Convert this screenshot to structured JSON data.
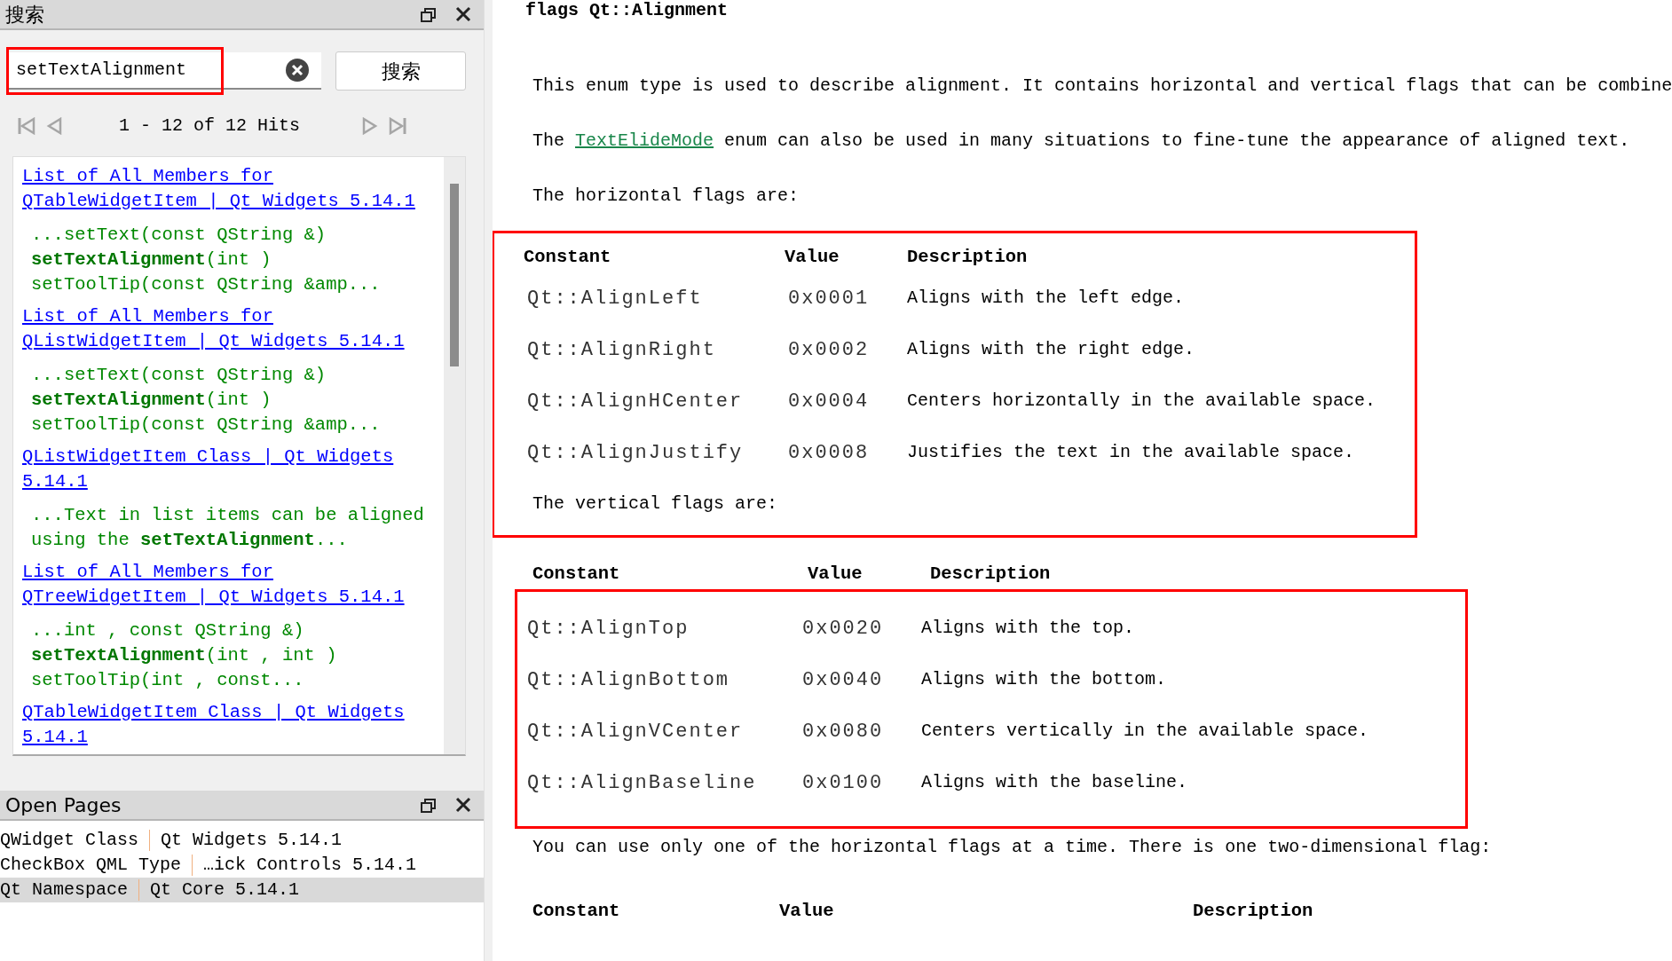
{
  "search_panel": {
    "title": "搜索",
    "query": "setTextAlignment",
    "query_framed": true,
    "search_button": "搜索",
    "hits": "1 - 12 of 12 Hits",
    "results": [
      {
        "title": "List of All Members for QTableWidgetItem | Qt Widgets 5.14.1",
        "snippet": "...setText(const QString &) **setTextAlignment**(int ) setToolTip(const QString &amp..."
      },
      {
        "title": "List of All Members for QListWidgetItem | Qt Widgets 5.14.1",
        "snippet": "...setText(const QString &) **setTextAlignment**(int ) setToolTip(const QString &amp..."
      },
      {
        "title": "QListWidgetItem Class | Qt Widgets 5.14.1",
        "snippet": "...Text in list items can be aligned using the **setTextAlignment**..."
      },
      {
        "title": "List of All Members for QTreeWidgetItem | Qt Widgets 5.14.1",
        "snippet": "...int , const QString &) **setTextAlignment**(int , int ) setToolTip(int , const..."
      },
      {
        "title": "QTableWidgetItem Class | Qt Widgets 5.14.1"
      }
    ]
  },
  "open_pages": {
    "title": "Open Pages",
    "items": [
      {
        "page": "QWidget Class",
        "module": "Qt Widgets 5.14.1",
        "selected": false
      },
      {
        "page": "CheckBox QML Type",
        "module": "…ick Controls 5.14.1",
        "selected": false
      },
      {
        "page": "Qt Namespace",
        "module": "Qt Core 5.14.1",
        "selected": true
      }
    ]
  },
  "document": {
    "blocks": [
      {
        "kind": "heading",
        "text": "flags Qt::Alignment"
      },
      {
        "kind": "paragraph",
        "parts": [
          {
            "text": "This enum type is used to describe alignment. It contains horizontal and vertical flags that can be combine"
          }
        ]
      },
      {
        "kind": "paragraph",
        "parts": [
          {
            "text": "The "
          },
          {
            "text": "TextElideMode",
            "link": true
          },
          {
            "text": " enum can also be used in many situations to fine-tune the appearance of aligned text."
          }
        ]
      },
      {
        "kind": "paragraph",
        "parts": [
          {
            "text": "The horizontal flags are:"
          }
        ]
      },
      {
        "kind": "table",
        "framed": true,
        "columns": [
          "Constant",
          "Value",
          "Description"
        ],
        "rows": [
          [
            "Qt::AlignLeft",
            "0x0001",
            "Aligns with the left edge."
          ],
          [
            "Qt::AlignRight",
            "0x0002",
            "Aligns with the right edge."
          ],
          [
            "Qt::AlignHCenter",
            "0x0004",
            "Centers horizontally in the available space."
          ],
          [
            "Qt::AlignJustify",
            "0x0008",
            "Justifies the text in the available space."
          ]
        ]
      },
      {
        "kind": "paragraph",
        "framed": true,
        "parts": [
          {
            "text": "The vertical flags are:"
          }
        ]
      },
      {
        "kind": "table",
        "rows_framed": true,
        "columns": [
          "Constant",
          "Value",
          "Description"
        ],
        "rows": [
          [
            "Qt::AlignTop",
            "0x0020",
            "Aligns with the top."
          ],
          [
            "Qt::AlignBottom",
            "0x0040",
            "Aligns with the bottom."
          ],
          [
            "Qt::AlignVCenter",
            "0x0080",
            "Centers vertically in the available space."
          ],
          [
            "Qt::AlignBaseline",
            "0x0100",
            "Aligns with the baseline."
          ]
        ]
      },
      {
        "kind": "paragraph",
        "parts": [
          {
            "text": "You can use only one of the horizontal flags at a time. There is one two-dimensional flag:"
          }
        ]
      },
      {
        "kind": "table",
        "columns": [
          "Constant",
          "Value",
          "Description"
        ]
      }
    ]
  }
}
